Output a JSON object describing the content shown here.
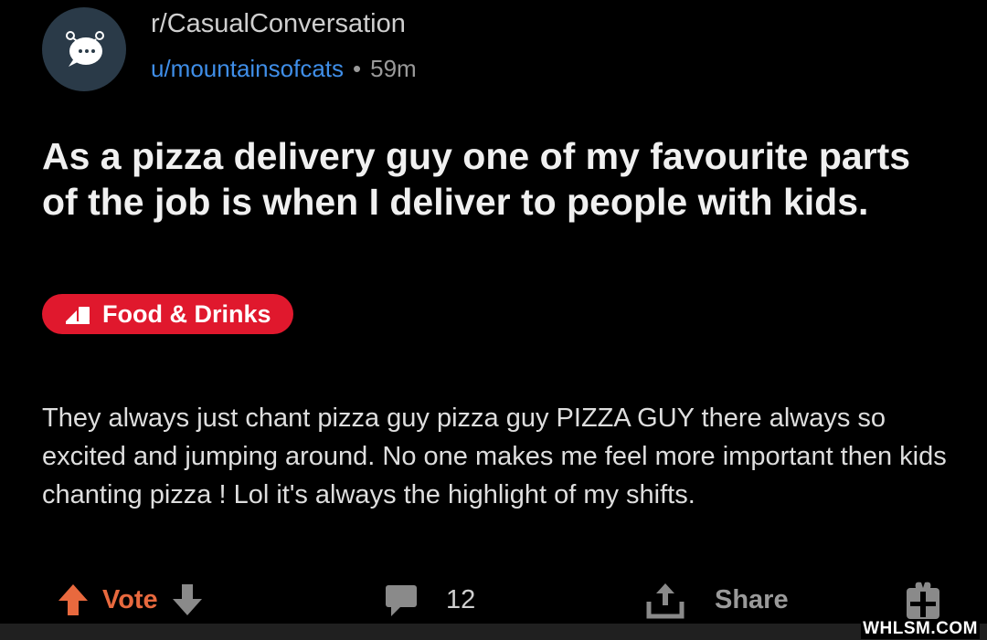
{
  "post": {
    "subreddit": "r/CasualConversation",
    "author": "u/mountainsofcats",
    "separator": "•",
    "age": "59m",
    "title": "As a pizza delivery guy one of my favourite parts of the job is when I deliver to people with kids.",
    "flair": "Food & Drinks",
    "body": "They always just chant pizza guy pizza guy PIZZA GUY there always so excited and jumping around. No one makes me feel more important then kids chanting pizza ! Lol it's always the highlight of my shifts."
  },
  "actions": {
    "vote_label": "Vote",
    "comment_count": "12",
    "share_label": "Share"
  },
  "icons": {
    "avatar": "subreddit-avatar-icon",
    "flair": "pizza-delivery-icon",
    "upvote": "upvote-arrow-icon",
    "downvote": "downvote-arrow-icon",
    "comment": "comment-bubble-icon",
    "share": "share-icon",
    "award": "award-gift-icon"
  },
  "colors": {
    "background": "#000000",
    "link": "#3f8ee8",
    "flair_bg": "#e0182d",
    "upvote": "#e8693e",
    "muted": "#9a9a9a"
  },
  "watermark": "WHLSM.COM"
}
